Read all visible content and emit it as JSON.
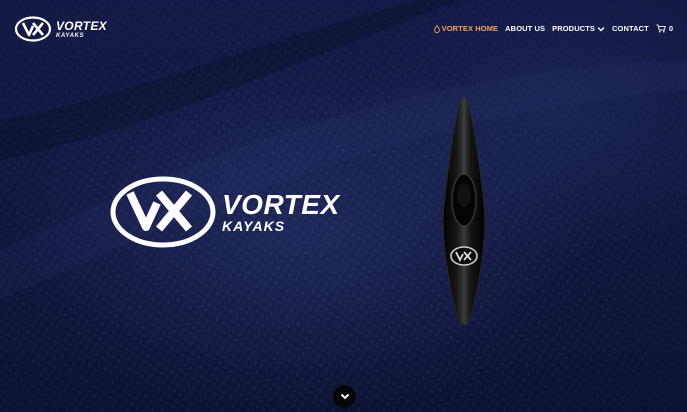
{
  "brand": {
    "logo_word_1": "VORTEX",
    "logo_word_2": "KAYAKS",
    "logo_mark": "VX"
  },
  "nav": {
    "items": [
      {
        "label": "VORTEX HOME",
        "active": true,
        "icon": "drop-icon"
      },
      {
        "label": "ABOUT US",
        "active": false
      },
      {
        "label": "PRODUCTS",
        "active": false,
        "icon": "chevron-down-icon"
      },
      {
        "label": "CONTACT",
        "active": false
      }
    ],
    "cart_count": "0"
  },
  "hero": {
    "word_1": "VORTEX",
    "word_2": "KAYAKS",
    "logo_mark": "VX",
    "kayak_badge": "VX"
  },
  "colors": {
    "background": "#0f1436",
    "accent": "#f2a562",
    "text": "#ffffff"
  }
}
